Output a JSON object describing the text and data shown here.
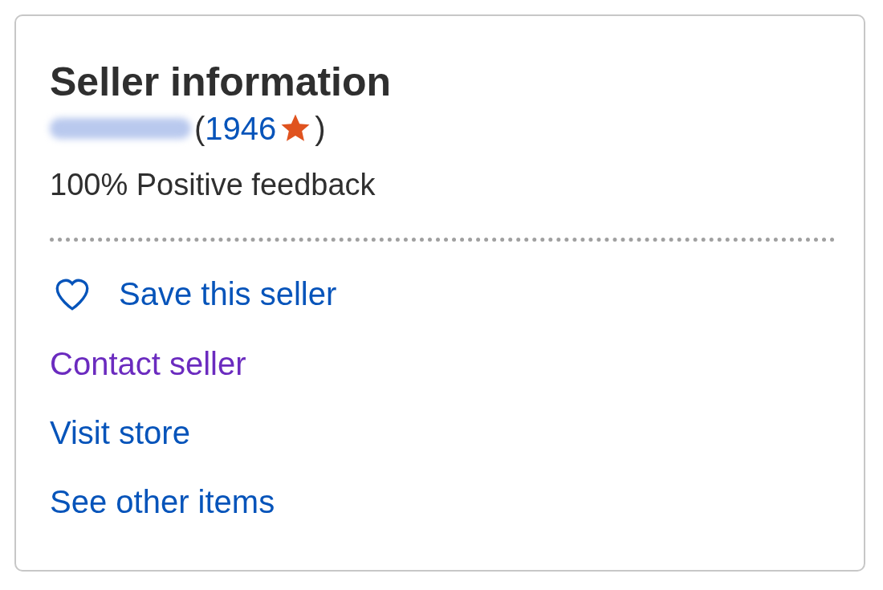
{
  "card": {
    "title": "Seller information",
    "score_open": "(",
    "feedback_score": "1946",
    "score_close": ")",
    "positive_feedback": "100% Positive feedback",
    "links": [
      {
        "kind": "save",
        "label": "Save this seller",
        "visited": false
      },
      {
        "kind": "link",
        "label": "Contact seller",
        "visited": true
      },
      {
        "kind": "link",
        "label": "Visit store",
        "visited": false
      },
      {
        "kind": "link",
        "label": "See other items",
        "visited": false
      }
    ]
  }
}
